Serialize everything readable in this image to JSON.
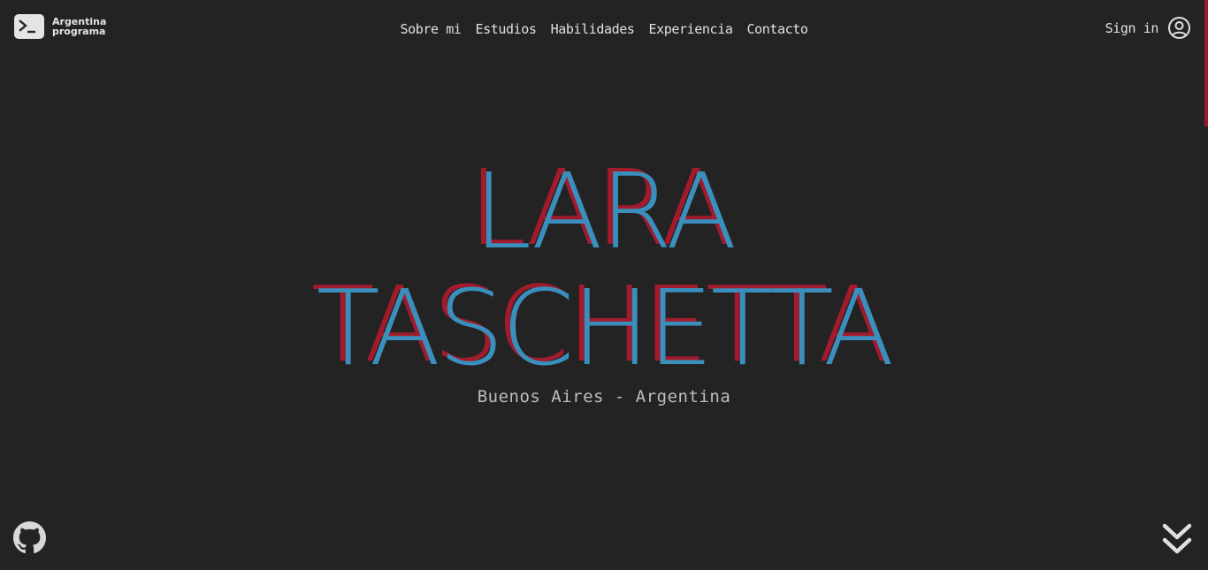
{
  "logo": {
    "line1": "Argentina",
    "line2": "programa",
    "icon": "terminal-icon"
  },
  "nav": {
    "items": [
      {
        "label": "Sobre mi"
      },
      {
        "label": "Estudios"
      },
      {
        "label": "Habilidades"
      },
      {
        "label": "Experiencia"
      },
      {
        "label": "Contacto"
      }
    ]
  },
  "account": {
    "label": "Sign in",
    "icon": "user-circle-icon"
  },
  "hero": {
    "first_name": "LARA",
    "last_name": "TASCHETTA",
    "location": "Buenos Aires - Argentina"
  },
  "footer": {
    "github_icon": "github-icon",
    "scroll_icon": "chevrons-down-icon"
  },
  "colors": {
    "background": "#232323",
    "name_blue": "#3a8fbd",
    "name_red": "#a11b2c",
    "text": "#e0e0e0"
  }
}
